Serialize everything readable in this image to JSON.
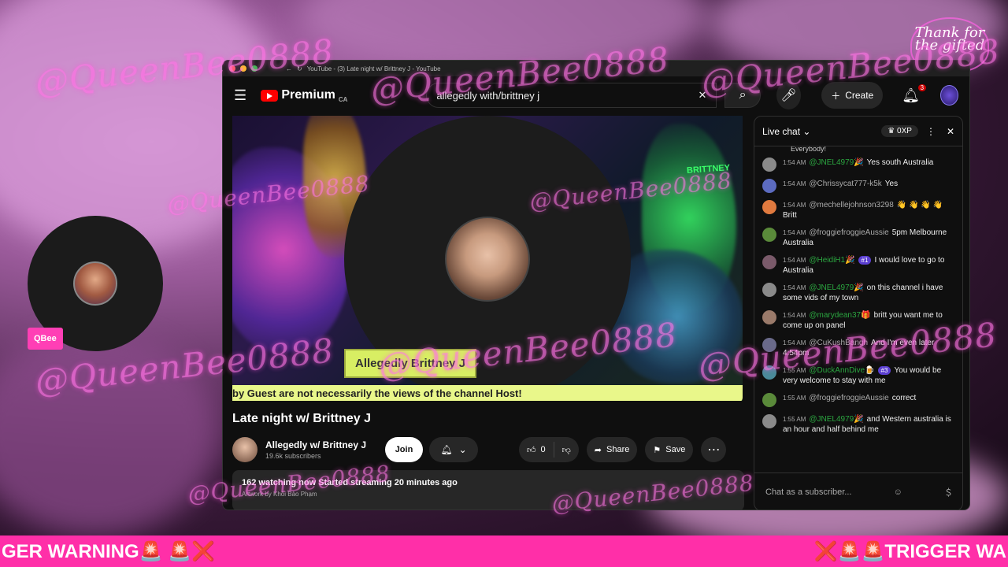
{
  "overlay": {
    "watermark": "@QueenBee0888",
    "corner_logo": "Thank for the gifted",
    "cam_badge": "QBee",
    "ticker_left": "GER WARNING🚨 🚨❌",
    "ticker_right": "❌🚨🚨TRIGGER WA"
  },
  "browser": {
    "tab_title": "YouTube - (3) Late night w/ Brittney J - YouTube",
    "logo_text": "Premium",
    "logo_region": "CA",
    "search_value": "allegedly with/brittney j",
    "create_label": "Create",
    "notif_count": "3"
  },
  "video": {
    "name_tag": "Allegedly Brittney J",
    "ticker": "by Guest are not necessarily the views of the channel Host!",
    "brand": "BRITTNEY"
  },
  "meta": {
    "title": "Late night w/ Brittney J",
    "channel_name": "Allegedly w/ Brittney J",
    "subscribers": "19.6k subscribers",
    "join_label": "Join",
    "like_count": "0",
    "share_label": "Share",
    "save_label": "Save",
    "watching": "162 watching now  Started streaming 20 minutes ago",
    "artwork_credit": "Artwork by Khôi Bảo Phạm"
  },
  "chat": {
    "title": "Live chat",
    "xp": "0XP",
    "top_fragment": "Everybody!",
    "messages": [
      {
        "time": "1:54 AM",
        "author": "@JNEL4979🎉",
        "member": true,
        "badge": "",
        "text": "Yes south Australia",
        "color": "#8a8a8a"
      },
      {
        "time": "1:54 AM",
        "author": "@Chrissycat777-k5k",
        "member": false,
        "badge": "",
        "text": "Yes",
        "color": "#5c6bc0"
      },
      {
        "time": "1:54 AM",
        "author": "@mechellejohnson3298",
        "member": false,
        "badge": "",
        "text": "👋 👋 👋 👋 Britt",
        "color": "#e07a3f"
      },
      {
        "time": "1:54 AM",
        "author": "@froggiefroggieAussie",
        "member": false,
        "badge": "",
        "text": "5pm Melbourne Australia",
        "color": "#5a8a3a"
      },
      {
        "time": "1:54 AM",
        "author": "@HeidiH1🎉",
        "member": true,
        "badge": "#1",
        "text": "I would love to go to Australia",
        "color": "#7a5a6a"
      },
      {
        "time": "1:54 AM",
        "author": "@JNEL4979🎉",
        "member": true,
        "badge": "",
        "text": "on this channel i have some vids of my town",
        "color": "#8a8a8a"
      },
      {
        "time": "1:54 AM",
        "author": "@marydean37🎁",
        "member": true,
        "badge": "",
        "text": "britt you want me to come up on panel",
        "color": "#9a7a6a"
      },
      {
        "time": "1:54 AM",
        "author": "@CuKushBangh",
        "member": false,
        "badge": "",
        "text": "And I'm even later 4:54pm",
        "color": "#6a6a8a"
      },
      {
        "time": "1:55 AM",
        "author": "@DuckAnnDive🍺",
        "member": true,
        "badge": "#3",
        "text": "You would be very welcome to stay with me",
        "color": "#4a8a9a"
      },
      {
        "time": "1:55 AM",
        "author": "@froggiefroggieAussie",
        "member": false,
        "badge": "",
        "text": "correct",
        "color": "#5a8a3a"
      },
      {
        "time": "1:55 AM",
        "author": "@JNEL4979🎉",
        "member": true,
        "badge": "",
        "text": "and Western australia is an hour and half behind me",
        "color": "#8a8a8a"
      }
    ],
    "input_placeholder": "Chat as a subscriber..."
  }
}
